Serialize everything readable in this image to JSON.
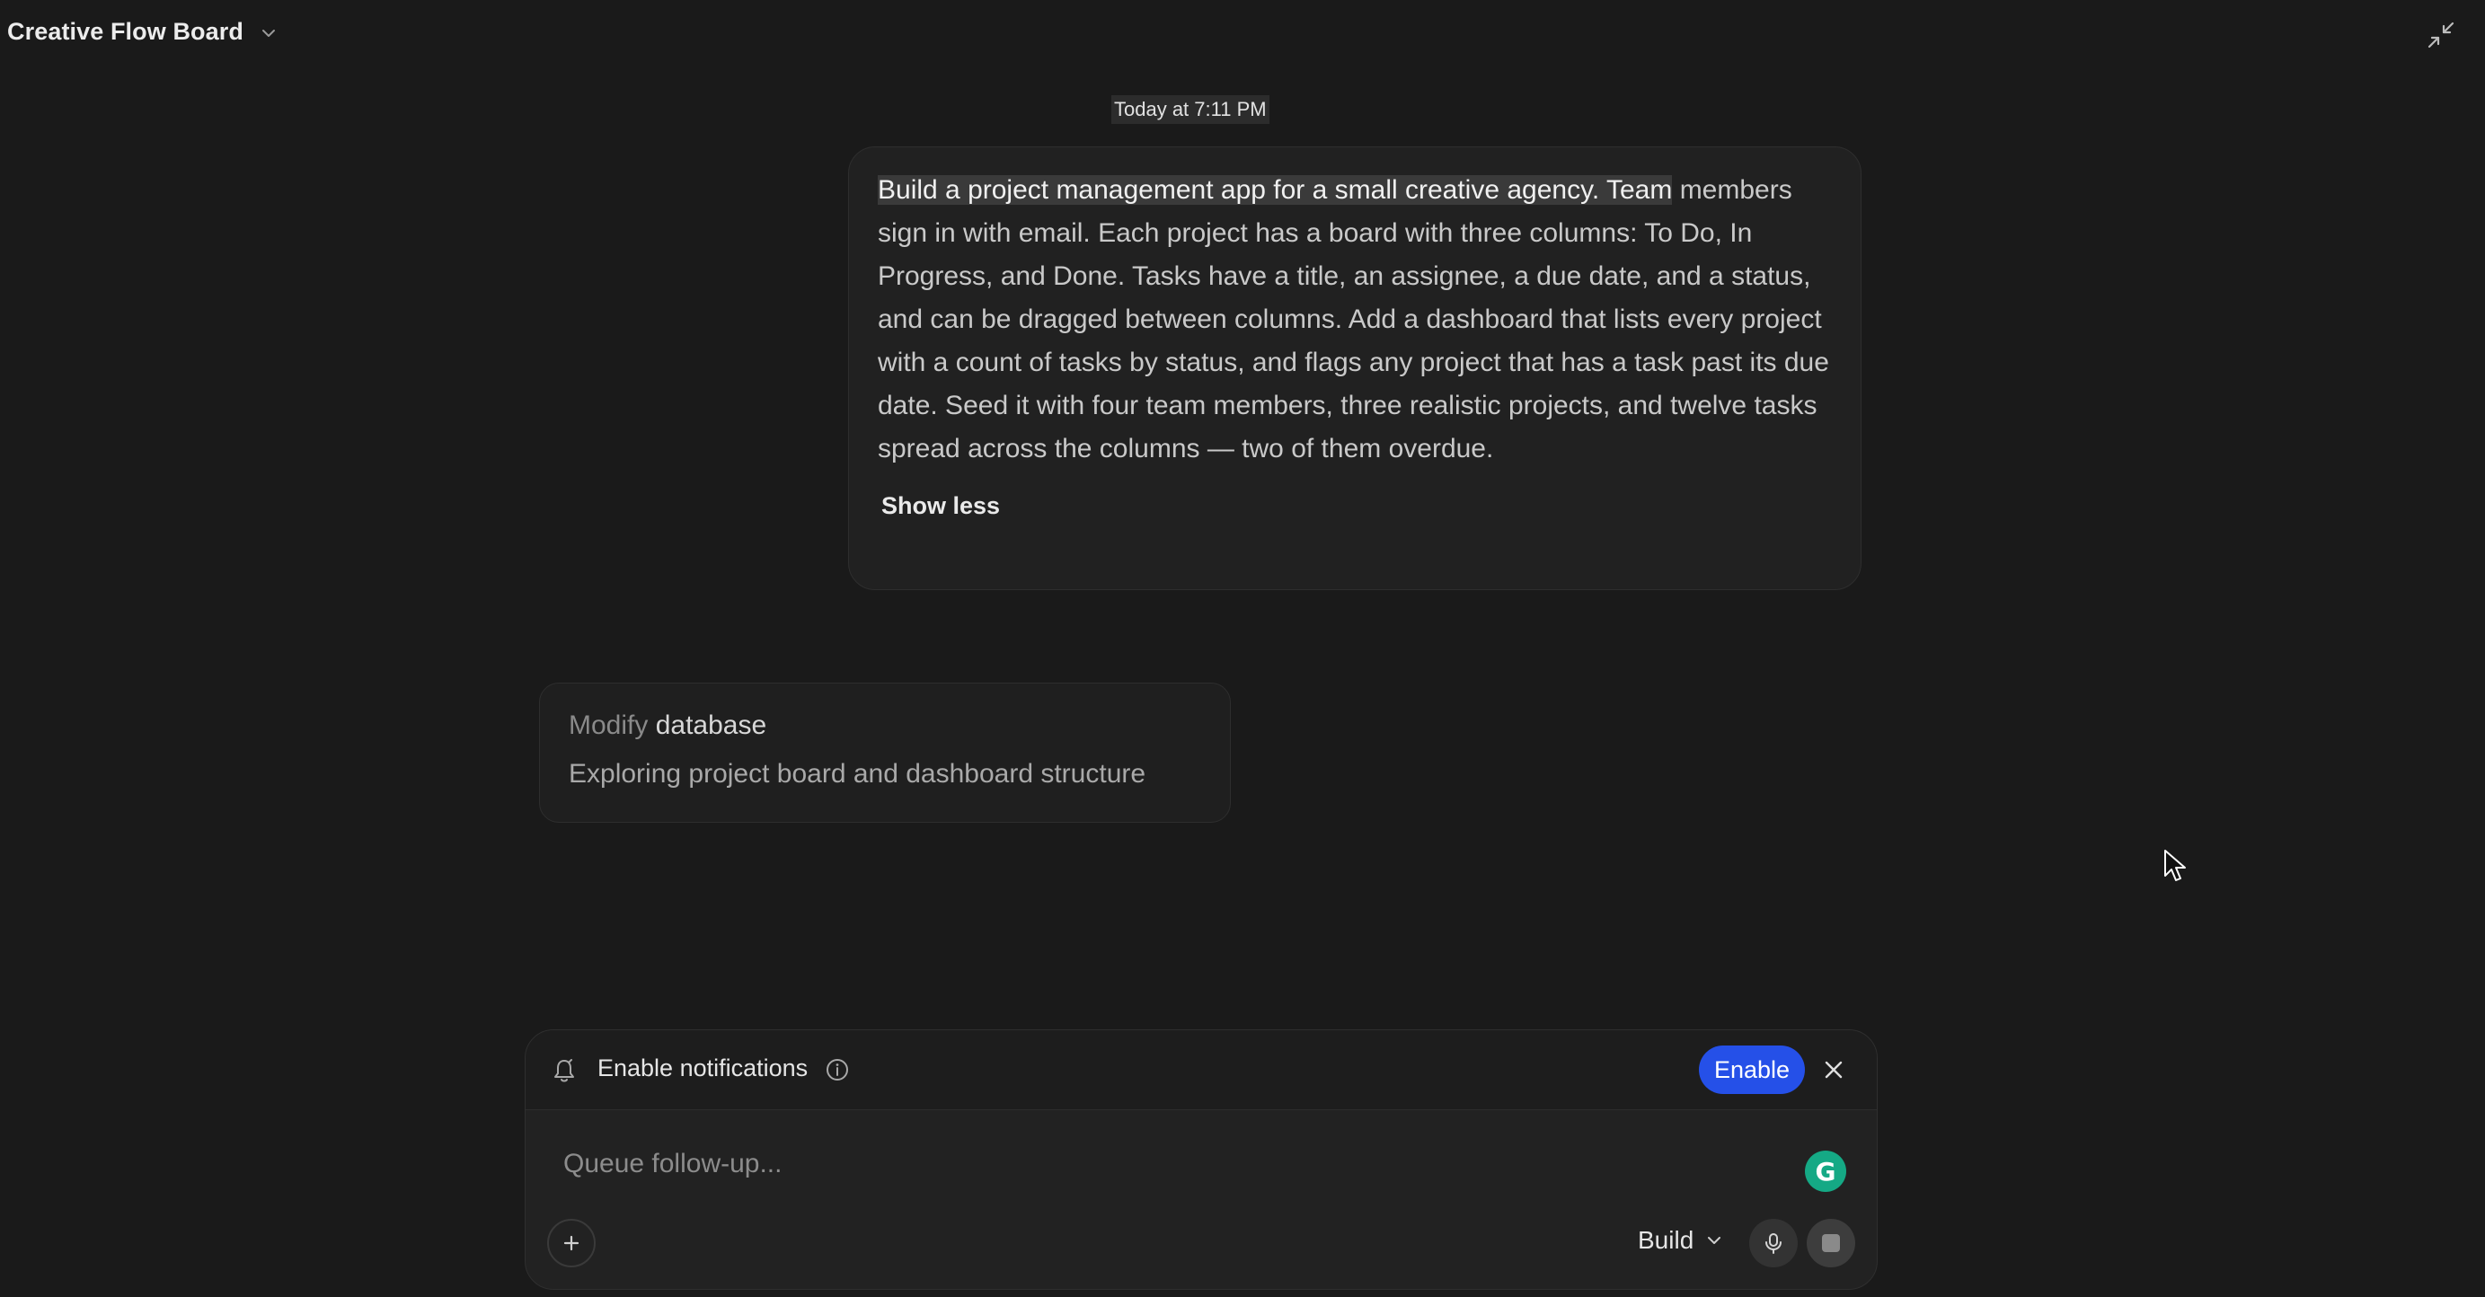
{
  "header": {
    "title": "Creative Flow Board",
    "title_chevron_icon": "chevron-down-icon",
    "collapse_icon": "collapse-arrows-icon"
  },
  "conversation": {
    "timestamp": "Today at 7:11 PM",
    "user_message": {
      "highlighted_text": "Build a project management app for a small creative agency. Team",
      "text": " members sign in with email. Each project has a board with three columns: To Do, In Progress, and Done. Tasks have a title, an assignee, a due date, and a status, and can be dragged between columns. Add a dashboard that lists every project with a count of tasks by status, and flags any project that has a task past its due date. Seed it with four team members, three realistic projects, and twelve tasks spread across the columns — two of them overdue.",
      "toggle_label": "Show less"
    },
    "activity": {
      "verb": "Modify",
      "target": "database",
      "description": "Exploring project board and dashboard structure"
    }
  },
  "notifications": {
    "label": "Enable notifications",
    "enable_label": "Enable",
    "bell_icon": "bell-icon",
    "info_icon": "info-icon",
    "close_icon": "close-icon"
  },
  "composer": {
    "placeholder": "Queue follow-up...",
    "grammarly_letter": "G",
    "mode": "Build",
    "add_icon": "plus-icon",
    "mic_icon": "microphone-icon",
    "stop_icon": "stop-icon"
  },
  "colors": {
    "background": "#1a1a1a",
    "bubble": "#212121",
    "accent_button": "#2550e8",
    "grammarly": "#15a985"
  }
}
